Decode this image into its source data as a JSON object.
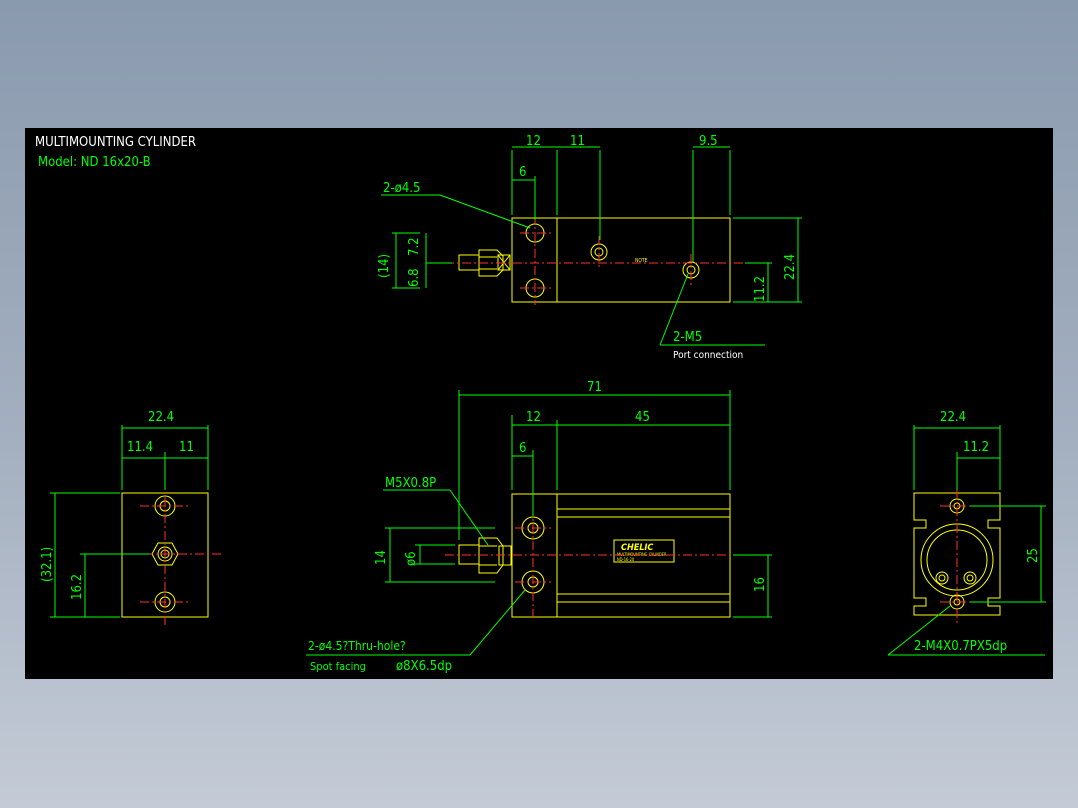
{
  "header": {
    "title": "MULTIMOUNTING CYLINDER",
    "model": "Model:  ND 16x20-B"
  },
  "top_view": {
    "dim_12": "12",
    "dim_11": "11",
    "dim_9_5": "9.5",
    "dim_6": "6",
    "hole_label": "2-ø4.5",
    "dim_14": "(14)",
    "dim_7_2": "7.2",
    "dim_6_8": "6.8",
    "dim_22_4": "22.4",
    "dim_11_2": "11.2",
    "port_label": "2-M5",
    "port_sub": "Port connection",
    "body_mark": "NOTE"
  },
  "left_view": {
    "dim_22_4": "22.4",
    "dim_11_4": "11.4",
    "dim_11": "11",
    "dim_32_1": "(32.1)",
    "dim_16_2": "16.2"
  },
  "front_view": {
    "dim_71": "71",
    "dim_12": "12",
    "dim_45": "45",
    "dim_6": "6",
    "thread_label": "M5X0.8P",
    "dim_14": "14",
    "dim_phi6": "ø6",
    "dim_16": "16",
    "brand": "CHELIC",
    "brand_sub1": "MULTIMOUNTING CYLINDER",
    "brand_sub2": "ND-16-20",
    "hole_note1": "2-ø4.5?Thru-hole?",
    "hole_note2_prefix": "Spot facing",
    "hole_note2_value": "ø8X6.5dp"
  },
  "right_view": {
    "dim_22_4": "22.4",
    "dim_11_2": "11.2",
    "dim_25": "25",
    "tap_label": "2-M4X0.7PX5dp"
  },
  "colors": {
    "background": "#000000",
    "dimension": "#00ff00",
    "outline": "#ffff00",
    "centerline": "#ff3030",
    "title_text": "#ffffff"
  }
}
